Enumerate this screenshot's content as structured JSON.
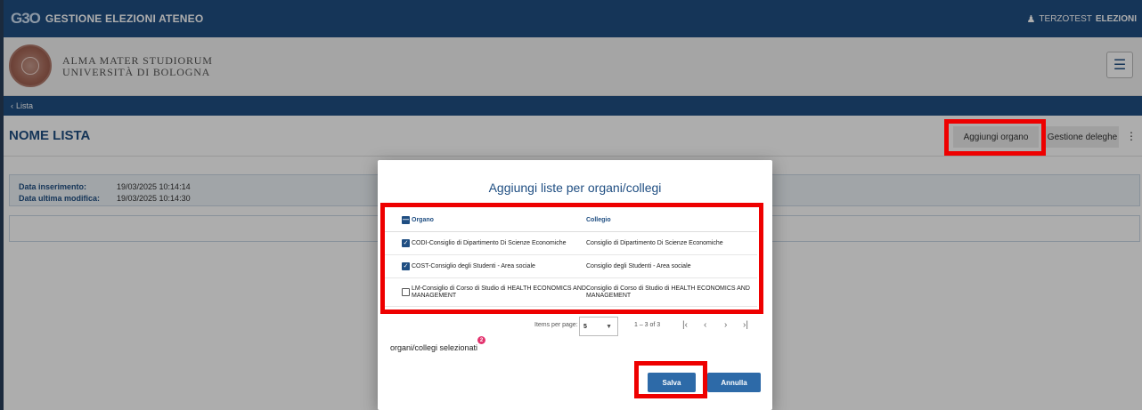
{
  "topbar": {
    "logo": "G3O",
    "app_title": "GESTIONE ELEZIONI ATENEO",
    "user_prefix": "TERZOTEST",
    "user_name": "ELEZIONI"
  },
  "header": {
    "university_line1": "ALMA MATER STUDIORUM",
    "university_line2": "UNIVERSITÀ DI BOLOGNA"
  },
  "breadcrumb": {
    "back_label": "Lista"
  },
  "page": {
    "title": "NOME LISTA",
    "add_button": "Aggiungi organo",
    "delegations_button": "Gestione deleghe",
    "info": {
      "inserted_label": "Data inserimento:",
      "inserted_value": "19/03/2025 10:14:14",
      "modified_label": "Data ultima modifica:",
      "modified_value": "19/03/2025 10:14:30"
    }
  },
  "dialog": {
    "title": "Aggiungi liste per organi/collegi",
    "columns": {
      "organo": "Organo",
      "collegio": "Collegio"
    },
    "rows": [
      {
        "organo": "CODI-Consiglio di Dipartimento Di Scienze Economiche",
        "collegio": "Consiglio di Dipartimento Di Scienze Economiche",
        "checked": true
      },
      {
        "organo": "COST-Consiglio degli Studenti - Area sociale",
        "collegio": "Consiglio degli Studenti - Area sociale",
        "checked": true
      },
      {
        "organo": "LM-Consiglio di Corso di Studio di HEALTH ECONOMICS AND MANAGEMENT",
        "collegio": "Consiglio di Corso di Studio di HEALTH ECONOMICS AND MANAGEMENT",
        "checked": false
      }
    ],
    "paginator": {
      "items_per_page_label": "Items per page:",
      "items_per_page": "5",
      "range": "1 – 3 of 3"
    },
    "selected_label": "organi/collegi selezionati",
    "selected_count": "2",
    "save_button": "Salva",
    "cancel_button": "Annulla"
  },
  "colors": {
    "primary": "#1f4e82",
    "button": "#2d6aa8",
    "highlight": "#ee0000",
    "badge": "#e3336e"
  }
}
